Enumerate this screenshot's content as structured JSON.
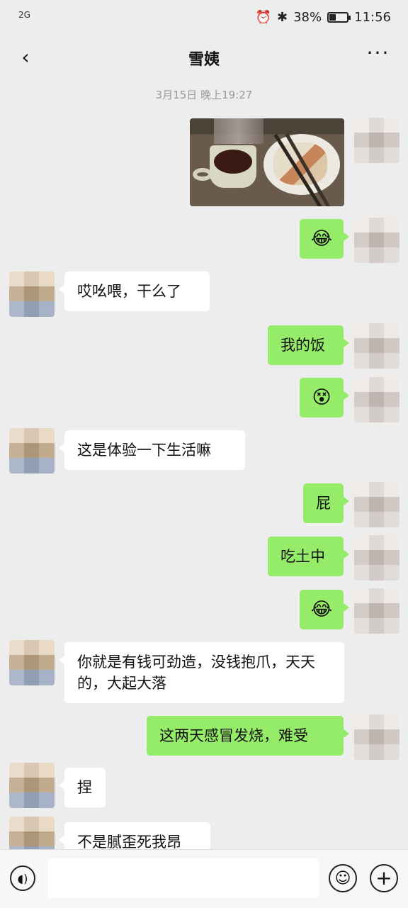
{
  "status_bar": {
    "network": "2G",
    "alarm_icon": "alarm-icon",
    "bluetooth_icon": "bluetooth-icon",
    "battery": "38%",
    "battery_level": 0.38,
    "time": "11:56"
  },
  "header": {
    "title": "雪姨",
    "back_icon": "back-icon",
    "more_label": "···"
  },
  "timestamp": "3月15日 晚上19:27",
  "messages": [
    {
      "from": "me",
      "type": "image",
      "content": "photo of a bowl of soup and a plate of food with chopsticks"
    },
    {
      "from": "me",
      "type": "emoji",
      "content": "😂"
    },
    {
      "from": "other",
      "type": "text",
      "content": "哎吆喂，干么了"
    },
    {
      "from": "me",
      "type": "text",
      "content": "我的饭"
    },
    {
      "from": "me",
      "type": "emoji",
      "content": "😵"
    },
    {
      "from": "other",
      "type": "text",
      "content": "这是体验一下生活嘛"
    },
    {
      "from": "me",
      "type": "text",
      "content": "屁"
    },
    {
      "from": "me",
      "type": "text",
      "content": "吃土中"
    },
    {
      "from": "me",
      "type": "emoji",
      "content": "😂"
    },
    {
      "from": "other",
      "type": "text",
      "content": "你就是有钱可劲造，没钱抱爪，天天的，大起大落"
    },
    {
      "from": "me",
      "type": "text",
      "content": "这两天感冒发烧，难受"
    },
    {
      "from": "other",
      "type": "text",
      "content": "捏"
    },
    {
      "from": "other",
      "type": "text",
      "content": "不是腻歪死我昂"
    }
  ],
  "input_bar": {
    "voice_icon": "voice-icon",
    "input_value": "",
    "emoji_icon": "emoji-icon",
    "plus_icon": "plus-icon"
  },
  "colors": {
    "background": "#ededed",
    "outgoing_bubble": "#95ec69",
    "incoming_bubble": "#ffffff"
  }
}
